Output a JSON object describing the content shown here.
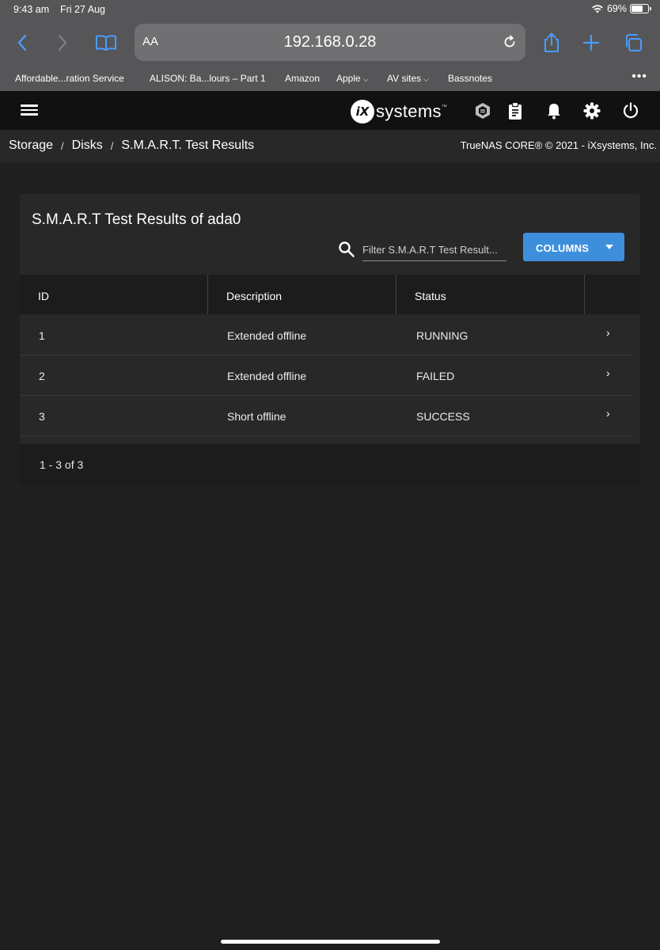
{
  "status_bar": {
    "time": "9:43 am",
    "date": "Fri 27 Aug",
    "battery": "69%",
    "battery_level": 0.69
  },
  "browser": {
    "text_size_label": "AA",
    "url": "192.168.0.28",
    "bookmarks": [
      {
        "label": "Affordable...ration Service",
        "has_menu": false
      },
      {
        "label": "ALISON: Ba...lours – Part 1",
        "has_menu": false
      },
      {
        "label": "Amazon",
        "has_menu": false
      },
      {
        "label": "Apple",
        "has_menu": true
      },
      {
        "label": "AV sites",
        "has_menu": true
      },
      {
        "label": "Bassnotes",
        "has_menu": false
      }
    ],
    "more": "•••"
  },
  "topbar": {
    "logo_mark": "iX",
    "logo_text": "systems"
  },
  "breadcrumb": {
    "items": [
      "Storage",
      "Disks",
      "S.M.A.R.T. Test Results"
    ],
    "separator": "/"
  },
  "copyright": "TrueNAS CORE® © 2021 - iXsystems, Inc.",
  "card": {
    "title": "S.M.A.R.T Test Results of ada0",
    "filter_placeholder": "Filter S.M.A.R.T Test Result...",
    "columns_button": "COLUMNS",
    "headers": [
      "ID",
      "Description",
      "Status"
    ],
    "rows": [
      {
        "id": "1",
        "description": "Extended offline",
        "status": "RUNNING"
      },
      {
        "id": "2",
        "description": "Extended offline",
        "status": "FAILED"
      },
      {
        "id": "3",
        "description": "Short offline",
        "status": "SUCCESS"
      }
    ],
    "row_arrow": "›",
    "pagination": "1 - 3 of 3"
  },
  "colors": {
    "accent": "#3e8fdb",
    "safari_chrome": "#565658",
    "topbar": "#111111",
    "background": "#1f1f1f",
    "card": "#282828"
  }
}
